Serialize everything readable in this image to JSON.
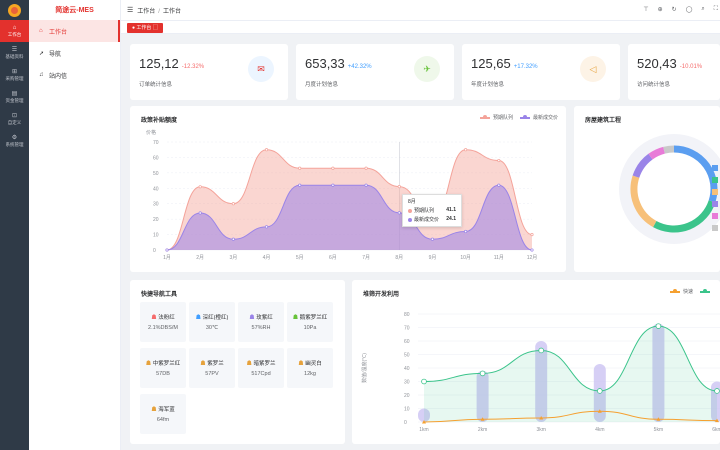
{
  "rail": {
    "items": [
      {
        "label": "工作台",
        "icon": "home-icon"
      },
      {
        "label": "基础资料",
        "icon": "list-icon"
      },
      {
        "label": "采购管理",
        "icon": "cart-icon"
      },
      {
        "label": "资金管理",
        "icon": "money-icon"
      },
      {
        "label": "自定义",
        "icon": "custom-icon"
      },
      {
        "label": "系统管理",
        "icon": "gear-icon"
      }
    ]
  },
  "brand": "简途云-MES",
  "submenu": [
    {
      "label": "工作台",
      "icon": "home-icon"
    },
    {
      "label": "导航",
      "icon": "nav-icon"
    },
    {
      "label": "站内信",
      "icon": "bell-icon"
    }
  ],
  "breadcrumb": [
    "工作台",
    "工作台"
  ],
  "tab": "工作台",
  "colors": {
    "accent": "#e3312d",
    "red": "#f56c6c",
    "blue": "#409eff"
  },
  "stats": [
    {
      "value": "125,12",
      "pct": "-12.32%",
      "label": "订单统计信息",
      "pct_color": "#f56c6c",
      "icon": "order-icon",
      "icon_color": "#e3312d",
      "bg": "#ecf5ff"
    },
    {
      "value": "653,33",
      "pct": "+42.32%",
      "label": "月度计划信息",
      "pct_color": "#409eff",
      "icon": "plan-icon",
      "icon_color": "#67c23a",
      "bg": "#eff8ea"
    },
    {
      "value": "125,65",
      "pct": "+17.32%",
      "label": "年度计划信息",
      "pct_color": "#409eff",
      "icon": "year-icon",
      "icon_color": "#e6a23c",
      "bg": "#fdf3e6"
    },
    {
      "value": "520,43",
      "pct": "-10.01%",
      "label": "访问统计信息",
      "pct_color": "#f56c6c",
      "icon": "visit-icon",
      "icon_color": "#409eff",
      "bg": "#ecf5ff"
    }
  ],
  "area_chart": {
    "title": "政策补贴额度",
    "legend": [
      "预期队列",
      "最新成交价"
    ],
    "chart_data": {
      "type": "area",
      "ylabel": "价格",
      "ylim": [
        0,
        70
      ],
      "yticks": [
        "0",
        "10",
        "20",
        "30",
        "40",
        "50",
        "60",
        "70"
      ],
      "categories": [
        "1月",
        "2月",
        "3月",
        "4月",
        "5月",
        "6月",
        "7月",
        "8月",
        "9月",
        "10月",
        "11月",
        "12月"
      ],
      "series": [
        {
          "name": "预期队列",
          "color": "#f4a39a",
          "values": [
            0,
            41,
            30,
            65,
            53,
            53,
            53,
            41.1,
            21,
            65,
            58,
            10
          ]
        },
        {
          "name": "最新成交价",
          "color": "#9a84e8",
          "values": [
            0,
            24,
            7,
            15,
            42,
            42,
            42,
            24.1,
            7,
            12,
            42,
            0
          ]
        }
      ]
    },
    "tooltip": {
      "title": "8月",
      "rows": [
        {
          "name": "预期队列",
          "value": "41.1"
        },
        {
          "name": "最新成交价",
          "value": "24.1"
        }
      ]
    }
  },
  "donut_chart": {
    "title": "房屋建筑工程",
    "chart_data": {
      "type": "pie",
      "values": [
        30,
        28,
        22,
        10,
        6,
        4
      ],
      "colors": [
        "#5b9ef0",
        "#3bc48b",
        "#f7c079",
        "#9a84e8",
        "#e87bd8",
        "#c9c9c9"
      ]
    }
  },
  "quicknav": {
    "title": "快捷导航工具",
    "items": [
      {
        "name": "法粉红",
        "value": "2.1%DBS/M",
        "color": "#f56c6c"
      },
      {
        "name": "深红(橙红)",
        "value": "30℃",
        "color": "#409eff"
      },
      {
        "name": "玫紫红",
        "value": "57%RH",
        "color": "#9a84e8"
      },
      {
        "name": "鹅紫罗兰红",
        "value": "10Pa",
        "color": "#67c23a"
      },
      {
        "name": "中紫罗兰红",
        "value": "57DB",
        "color": "#e6a23c"
      },
      {
        "name": "紫罗兰",
        "value": "57PV",
        "color": "#e6a23c"
      },
      {
        "name": "暗紫罗兰",
        "value": "517Cpd",
        "color": "#e6a23c"
      },
      {
        "name": "幽灵白",
        "value": "12kg",
        "color": "#e6a23c"
      },
      {
        "name": "海军蓝",
        "value": "64fm",
        "color": "#e6a23c"
      }
    ]
  },
  "mixed_chart": {
    "title": "堆筛开发利用",
    "legend": [
      "快速",
      ""
    ],
    "chart_data": {
      "type": "line",
      "ylabel": "数值/温度(℃)",
      "ylim": [
        0,
        80
      ],
      "yticks": [
        "0",
        "10",
        "20",
        "30",
        "40",
        "50",
        "60",
        "70",
        "80"
      ],
      "categories": [
        "1km",
        "2km",
        "3km",
        "4km",
        "5km",
        "6km"
      ],
      "series": [
        {
          "name": "",
          "type": "bar",
          "color": "#c8bff2",
          "values": [
            10,
            38,
            60,
            43,
            73,
            30
          ]
        },
        {
          "name": "",
          "type": "line",
          "color": "#3bc48b",
          "values": [
            30,
            36,
            53,
            23,
            71,
            23
          ]
        },
        {
          "name": "快速",
          "type": "line",
          "color": "#f5a030",
          "values": [
            0,
            2,
            3,
            8,
            2,
            1
          ]
        }
      ]
    }
  }
}
